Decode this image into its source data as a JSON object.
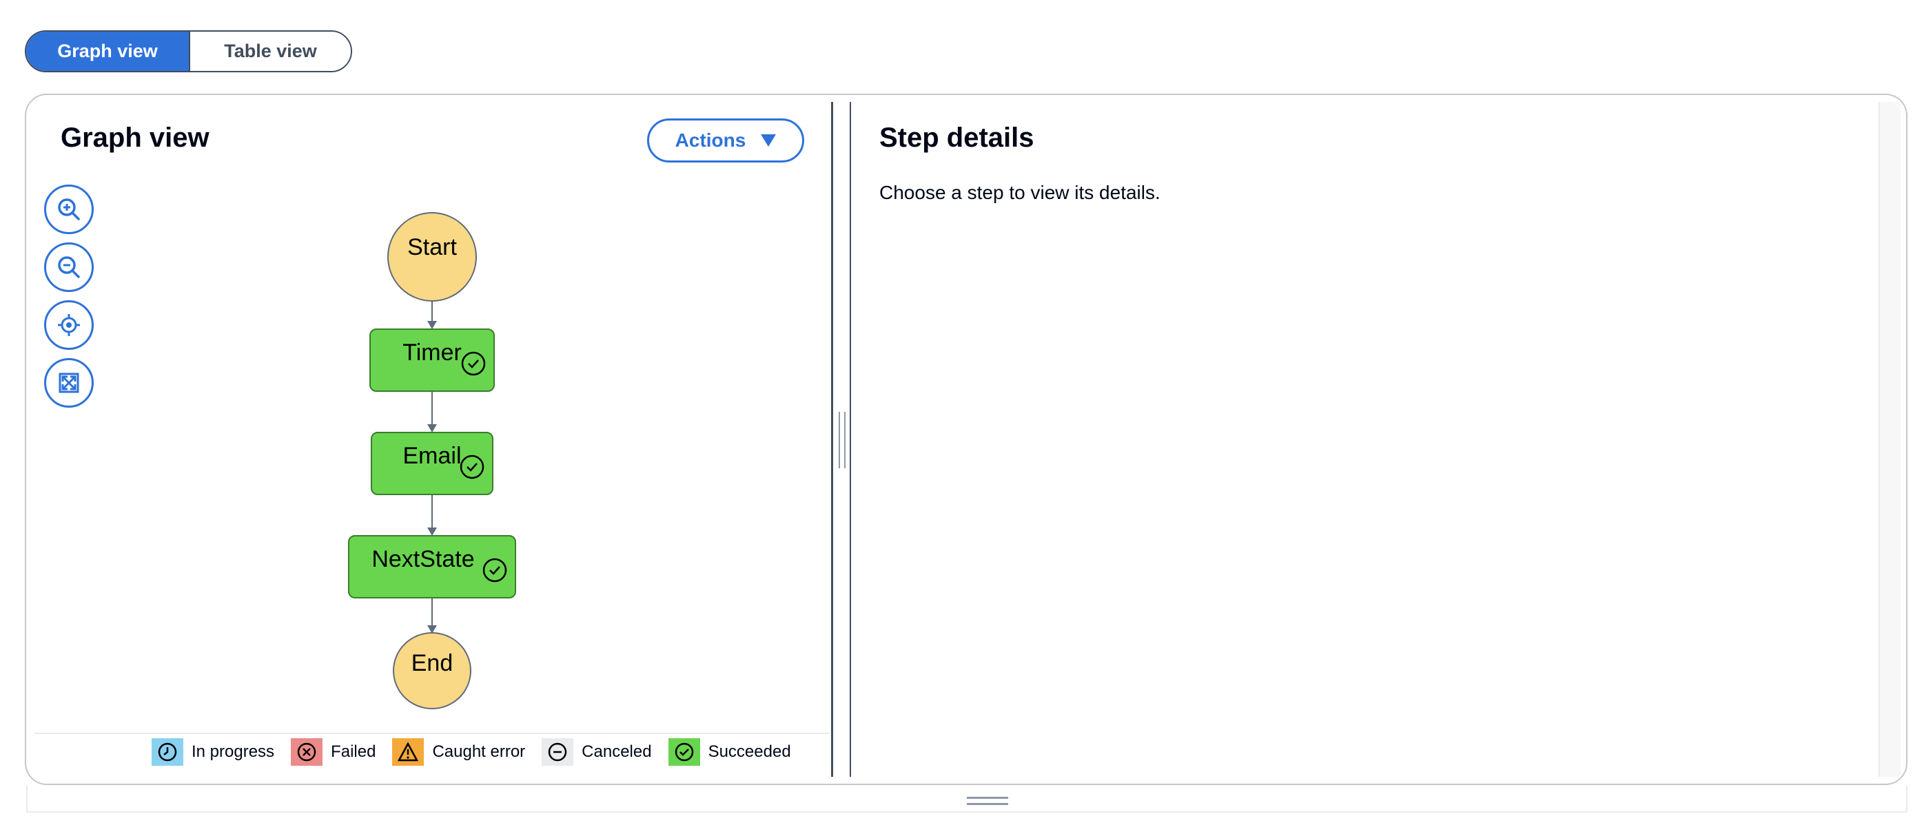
{
  "view_toggle": {
    "graph_label": "Graph view",
    "table_label": "Table view"
  },
  "graph_pane": {
    "title": "Graph view",
    "actions_label": "Actions"
  },
  "flow": {
    "start": "Start",
    "end": "End",
    "states": [
      {
        "name": "Timer",
        "status": "Succeeded"
      },
      {
        "name": "Email",
        "status": "Succeeded"
      },
      {
        "name": "NextState",
        "status": "Succeeded"
      }
    ]
  },
  "legend": [
    {
      "label": "In progress",
      "color": "#8ad1f0",
      "icon": "clock-icon"
    },
    {
      "label": "Failed",
      "color": "#ec8a8a",
      "icon": "x-circle-icon"
    },
    {
      "label": "Caught error",
      "color": "#f4a93a",
      "icon": "warning-icon"
    },
    {
      "label": "Canceled",
      "color": "#e9ebed",
      "icon": "minus-circle-icon"
    },
    {
      "label": "Succeeded",
      "color": "#69d54e",
      "icon": "check-circle-icon"
    }
  ],
  "details_pane": {
    "title": "Step details",
    "placeholder": "Choose a step to view its details."
  },
  "colors": {
    "accent": "#2e72d9",
    "start_end_node": "#f9d886",
    "succeeded_node": "#69d54e"
  }
}
